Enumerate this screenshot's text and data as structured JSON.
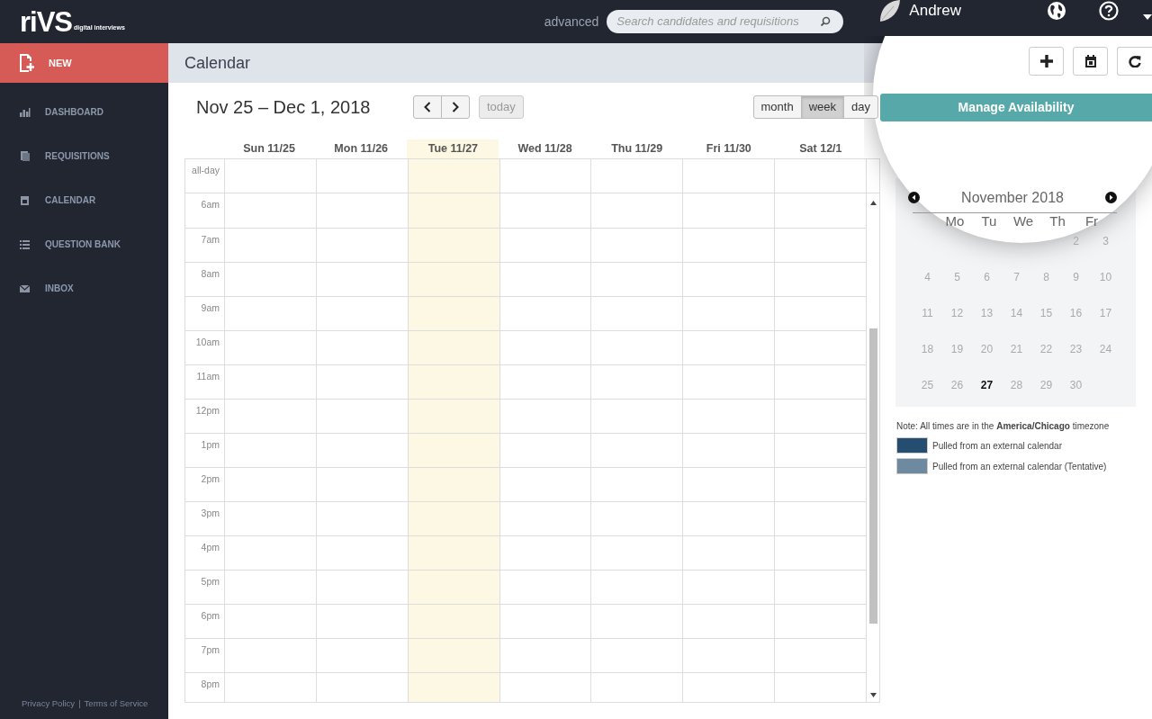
{
  "topbar": {
    "logo": {
      "mark": "riVS",
      "tagline": "digital interviews"
    },
    "advanced_link": "advanced",
    "search": {
      "placeholder": "Search candidates and requisitions"
    },
    "user_name": "Andrew"
  },
  "sidebar": {
    "new_button": "NEW",
    "items": [
      {
        "label": "DASHBOARD",
        "kind": "dashboard"
      },
      {
        "label": "REQUISITIONS",
        "kind": "requisitions"
      },
      {
        "label": "CALENDAR",
        "kind": "calendar"
      },
      {
        "label": "QUESTION BANK",
        "kind": "questions"
      },
      {
        "label": "INBOX",
        "kind": "inbox"
      }
    ],
    "footer_links": [
      "Privacy Policy",
      "Terms of Service"
    ],
    "footer_separator": "|"
  },
  "page_title": "Calendar",
  "calendar": {
    "range_title": "Nov 25 – Dec 1, 2018",
    "today_button": {
      "label": "today",
      "disabled": true
    },
    "views": [
      {
        "label": "month",
        "selected": false
      },
      {
        "label": "week",
        "selected": true
      },
      {
        "label": "day",
        "selected": false
      }
    ],
    "days": [
      {
        "label": "Sun 11/25",
        "today": false
      },
      {
        "label": "Mon 11/26",
        "today": false
      },
      {
        "label": "Tue 11/27",
        "today": true
      },
      {
        "label": "Wed 11/28",
        "today": false
      },
      {
        "label": "Thu 11/29",
        "today": false
      },
      {
        "label": "Fri 11/30",
        "today": false
      },
      {
        "label": "Sat 12/1",
        "today": false
      }
    ],
    "all_day_label": "all-day",
    "times": [
      "6am",
      "7am",
      "8am",
      "9am",
      "10am",
      "11am",
      "12pm",
      "1pm",
      "2pm",
      "3pm",
      "4pm",
      "5pm",
      "6pm",
      "7pm",
      "8pm"
    ]
  },
  "side_panel": {
    "manage_button": "Manage Availability",
    "mini_calendar": {
      "month_title": "November 2018",
      "weekdays": [
        "Mo",
        "Tu",
        "We",
        "Th",
        "Fr"
      ],
      "weeks": [
        [
          {
            "label": "2",
            "today": false
          },
          {
            "label": "3",
            "today": false
          }
        ],
        [
          {
            "label": "4",
            "today": false
          },
          {
            "label": "5",
            "today": false
          },
          {
            "label": "6",
            "today": false
          },
          {
            "label": "7",
            "today": false
          },
          {
            "label": "8",
            "today": false
          },
          {
            "label": "9",
            "today": false
          },
          {
            "label": "10",
            "today": false
          }
        ],
        [
          {
            "label": "11",
            "today": false
          },
          {
            "label": "12",
            "today": false
          },
          {
            "label": "13",
            "today": false
          },
          {
            "label": "14",
            "today": false
          },
          {
            "label": "15",
            "today": false
          },
          {
            "label": "16",
            "today": false
          },
          {
            "label": "17",
            "today": false
          }
        ],
        [
          {
            "label": "18",
            "today": false
          },
          {
            "label": "19",
            "today": false
          },
          {
            "label": "20",
            "today": false
          },
          {
            "label": "21",
            "today": false
          },
          {
            "label": "22",
            "today": false
          },
          {
            "label": "23",
            "today": false
          },
          {
            "label": "24",
            "today": false
          }
        ],
        [
          {
            "label": "25",
            "today": false
          },
          {
            "label": "26",
            "today": false
          },
          {
            "label": "27",
            "today": true
          },
          {
            "label": "28",
            "today": false
          },
          {
            "label": "29",
            "today": false
          },
          {
            "label": "30",
            "today": false
          }
        ]
      ]
    },
    "note": "Note: All times are in the **America/Chicago** timezone",
    "legend": [
      {
        "label": "Pulled from an external calendar",
        "color": "#244d70"
      },
      {
        "label": "Pulled from an external calendar (Tentative)",
        "color": "#6e8aa0"
      }
    ]
  }
}
